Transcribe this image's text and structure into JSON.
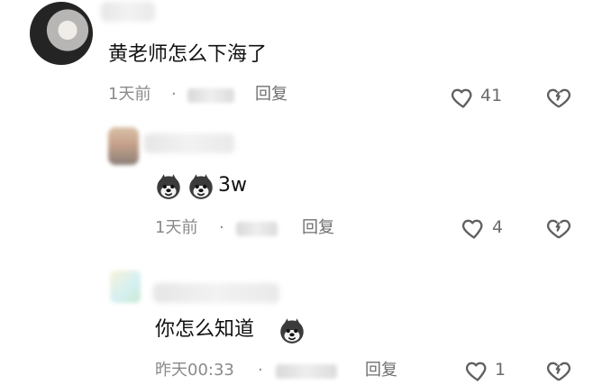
{
  "comments": [
    {
      "text": "黄老师怎么下海了",
      "time": "1天前",
      "dot": "·",
      "reply_label": "回复",
      "likes": "41"
    },
    {
      "text": "3w",
      "time": "1天前",
      "dot": "·",
      "reply_label": "回复",
      "likes": "4"
    },
    {
      "text": "你怎么知道",
      "time": "昨天00:33",
      "dot": "·",
      "reply_label": "回复",
      "likes": "1"
    }
  ],
  "icons": {
    "like": "heart-outline-icon",
    "dislike": "broken-heart-icon",
    "emoji": "husky-emoji-icon"
  },
  "colors": {
    "text": "#111111",
    "meta": "#8a8a8a",
    "icon": "#5f5f5f",
    "background": "#ffffff"
  }
}
